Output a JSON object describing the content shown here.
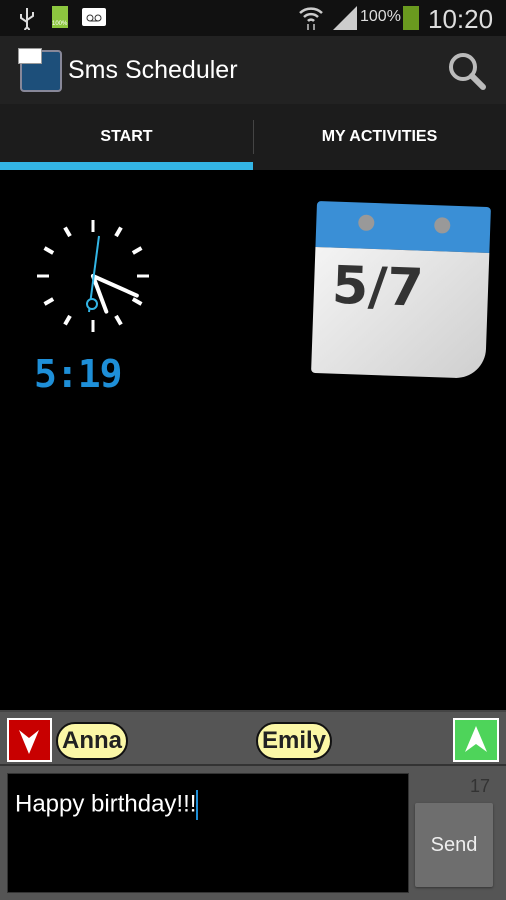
{
  "status_bar": {
    "battery_small": "100%",
    "battery_percent": "100%",
    "time": "10:20",
    "icons": [
      "usb-icon",
      "battery-icon",
      "voicemail-icon",
      "wifi-icon",
      "signal-icon",
      "battery-icon"
    ]
  },
  "app": {
    "title": "Sms Scheduler",
    "search_icon": "search-icon"
  },
  "tabs": [
    {
      "label": "START",
      "active": true
    },
    {
      "label": "MY ACTIVITIES",
      "active": false
    }
  ],
  "accent": "#33b5e5",
  "clock": {
    "digital_time": "5:19",
    "hour": 5,
    "minute": 19
  },
  "calendar": {
    "date": "5/7"
  },
  "contacts": {
    "chips": [
      "Anna",
      "Emily"
    ],
    "down_icon": "arrow-down-icon",
    "up_icon": "arrow-up-icon"
  },
  "compose": {
    "message": "Happy birthday!!!",
    "char_count": "17",
    "send_label": "Send"
  }
}
